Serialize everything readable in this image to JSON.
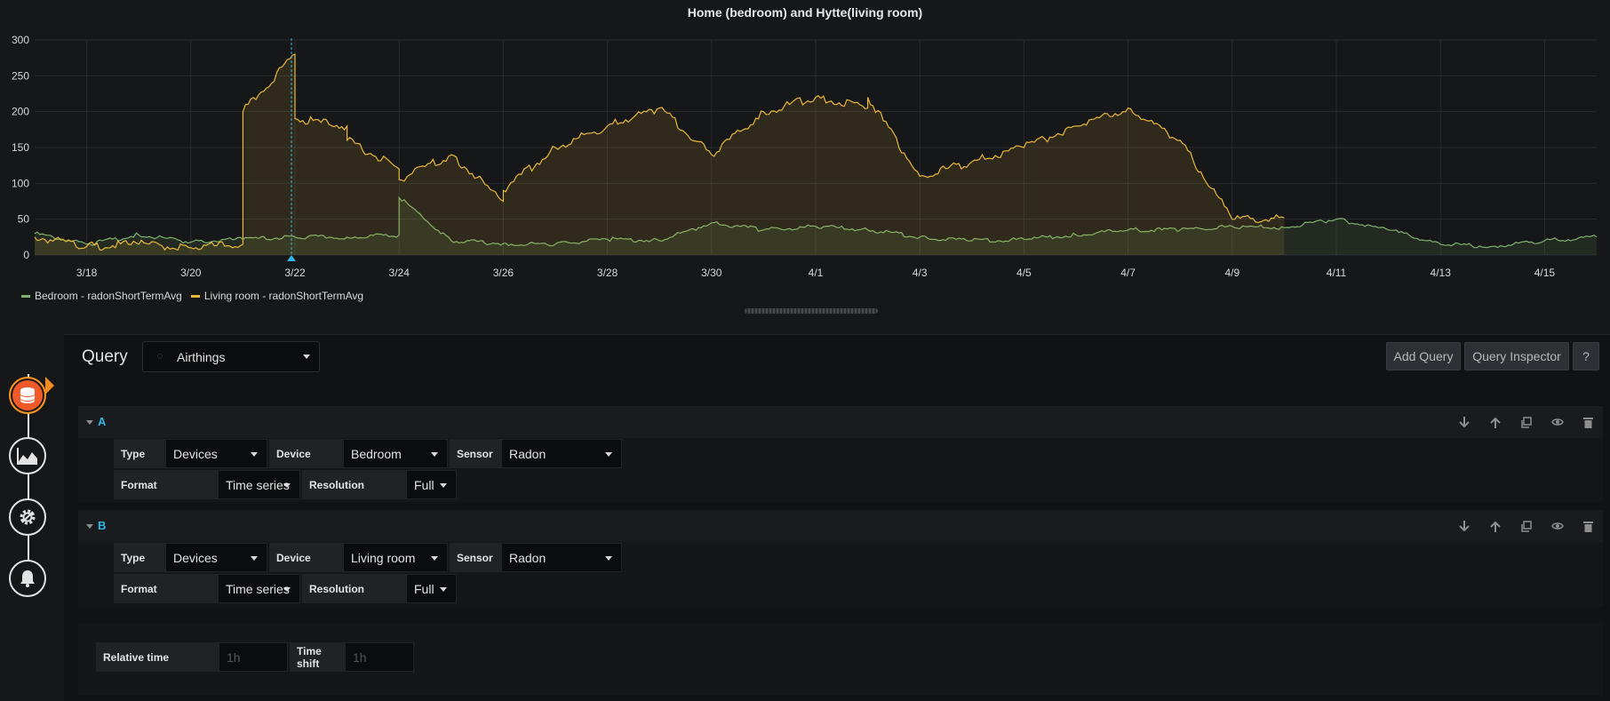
{
  "chart_data": {
    "type": "area",
    "title": "Home (bedroom) and Hytte(living room)",
    "xlabel": "",
    "ylabel": "",
    "ylim": [
      0,
      300
    ],
    "yticks": [
      0,
      50,
      100,
      150,
      200,
      250,
      300
    ],
    "xlim": [
      "3/17",
      "4/16"
    ],
    "xticks": [
      "3/18",
      "3/20",
      "3/22",
      "3/24",
      "3/26",
      "3/28",
      "3/30",
      "4/1",
      "4/3",
      "4/5",
      "4/7",
      "4/9",
      "4/11",
      "4/13",
      "4/15"
    ],
    "grid": true,
    "legend_position": "bottom-left",
    "series": [
      {
        "name": "Bedroom - radonShortTermAvg",
        "color": "#7eb26d",
        "x": [
          "3/17",
          "3/18",
          "3/19",
          "3/20",
          "3/21",
          "3/22",
          "3/23",
          "3/24",
          "3/24",
          "3/25",
          "3/26",
          "3/27",
          "3/28",
          "3/29",
          "3/30",
          "3/31",
          "4/1",
          "4/2",
          "4/3",
          "4/4",
          "4/5",
          "4/6",
          "4/7",
          "4/8",
          "4/9",
          "4/10",
          "4/11",
          "4/12",
          "4/13",
          "4/14",
          "4/15",
          "4/16"
        ],
        "values": [
          30,
          15,
          28,
          18,
          22,
          25,
          25,
          28,
          80,
          20,
          16,
          15,
          22,
          20,
          45,
          35,
          40,
          35,
          25,
          20,
          22,
          28,
          35,
          35,
          40,
          38,
          50,
          35,
          15,
          12,
          20,
          25
        ]
      },
      {
        "name": "Living room - radonShortTermAvg",
        "color": "#eab839",
        "x": [
          "3/17",
          "3/18",
          "3/19",
          "3/20",
          "3/21",
          "3/21",
          "3/22",
          "3/22",
          "3/23",
          "3/23",
          "3/24",
          "3/24",
          "3/25",
          "3/26",
          "3/26",
          "3/27",
          "3/28",
          "3/29",
          "3/30",
          "3/31",
          "4/1",
          "4/2",
          "4/2",
          "4/3",
          "4/4",
          "4/5",
          "4/6",
          "4/7",
          "4/8",
          "4/9",
          "4/10"
        ],
        "values": [
          25,
          12,
          15,
          10,
          15,
          200,
          280,
          190,
          180,
          160,
          120,
          105,
          140,
          75,
          90,
          150,
          180,
          205,
          140,
          200,
          220,
          205,
          220,
          110,
          130,
          150,
          180,
          205,
          160,
          50,
          52
        ]
      }
    ]
  },
  "legend": [
    {
      "label": "Bedroom - radonShortTermAvg",
      "color": "#7eb26d"
    },
    {
      "label": "Living room - radonShortTermAvg",
      "color": "#eab839"
    }
  ],
  "toolbar": {
    "title": "Query",
    "datasource": "Airthings",
    "add_query": "Add Query",
    "query_inspector": "Query Inspector",
    "help": "?"
  },
  "queries": [
    {
      "ref": "A",
      "type_label": "Type",
      "type_value": "Devices",
      "device_label": "Device",
      "device_value": "Bedroom",
      "sensor_label": "Sensor",
      "sensor_value": "Radon",
      "format_label": "Format",
      "format_value": "Time series",
      "resolution_label": "Resolution",
      "resolution_value": "Full"
    },
    {
      "ref": "B",
      "type_label": "Type",
      "type_value": "Devices",
      "device_label": "Device",
      "device_value": "Living room",
      "sensor_label": "Sensor",
      "sensor_value": "Radon",
      "format_label": "Format",
      "format_value": "Time series",
      "resolution_label": "Resolution",
      "resolution_value": "Full"
    }
  ],
  "time_options": {
    "relative_label": "Relative time",
    "relative_placeholder": "1h",
    "shift_label": "Time shift",
    "shift_placeholder": "1h"
  },
  "rail": [
    {
      "icon": "database-icon",
      "active": true
    },
    {
      "icon": "area-chart-icon",
      "active": false
    },
    {
      "icon": "gear-icon",
      "active": false
    },
    {
      "icon": "bell-icon",
      "active": false
    }
  ]
}
